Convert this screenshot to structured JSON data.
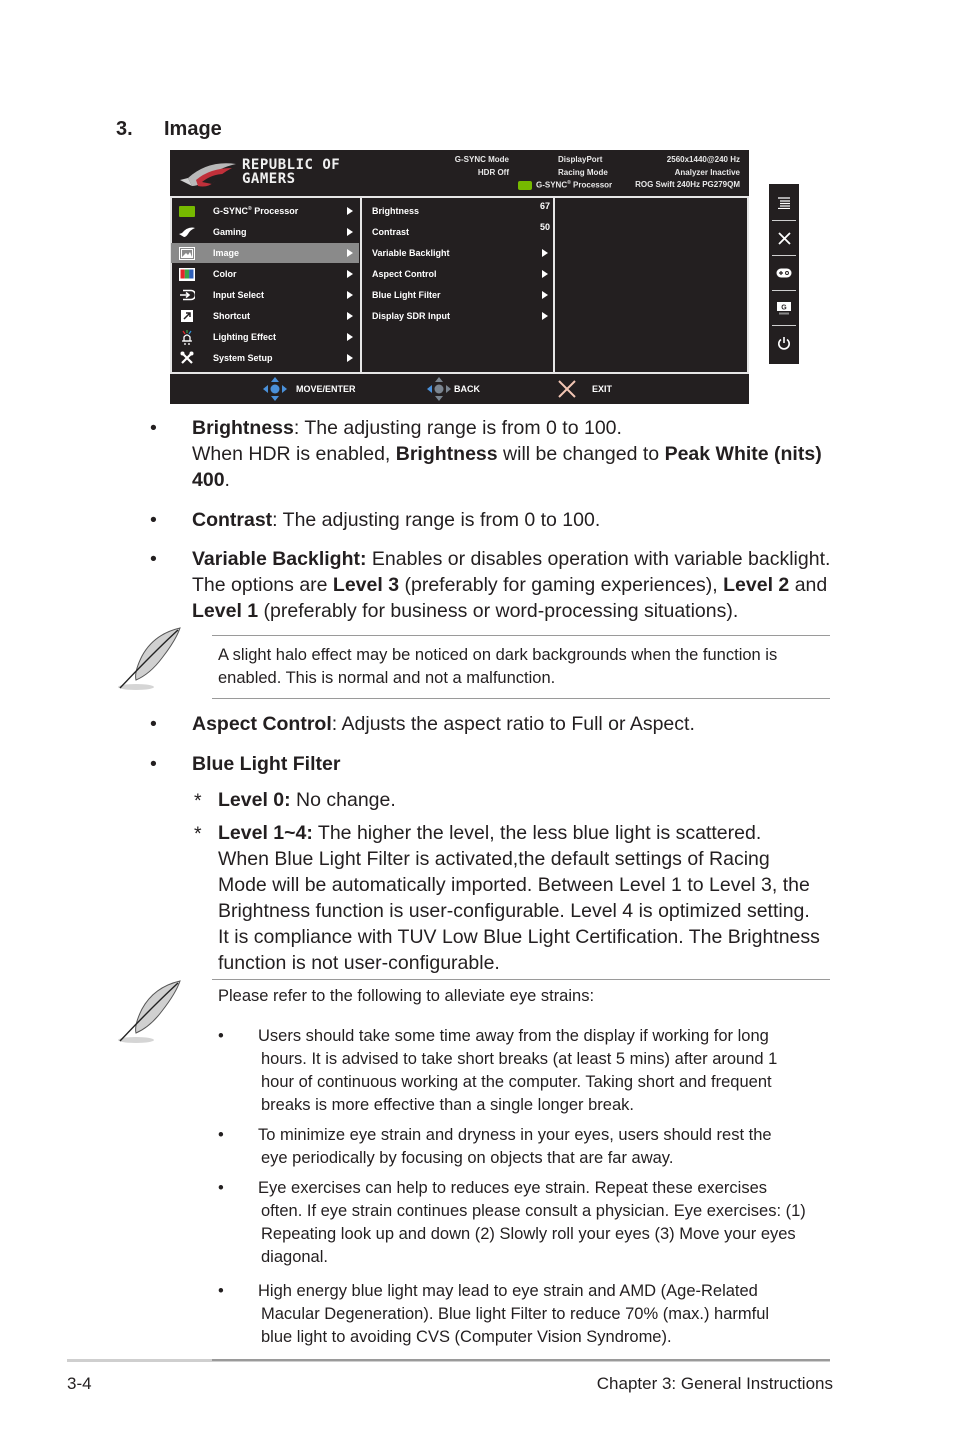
{
  "section": {
    "number": "3.",
    "title": "Image"
  },
  "osd": {
    "brand": {
      "line1": "REPUBLIC OF",
      "line2": "GAMERS"
    },
    "status": {
      "col1": [
        "G-SYNC Mode",
        "HDR Off"
      ],
      "col2": [
        "DisplayPort",
        "Racing Mode"
      ],
      "col2_processor": "G-SYNC",
      "col2_processor_suffix": " Processor",
      "col3": [
        "2560x1440@240 Hz",
        "Analyzer Inactive",
        "ROG Swift 240Hz PG279QM"
      ]
    },
    "main_menu": [
      {
        "label": "G-SYNC",
        "suffix": " Processor",
        "icon": "nvidia-icon",
        "selected": false
      },
      {
        "label": "Gaming",
        "icon": "rog-eye-icon",
        "selected": false
      },
      {
        "label": "Image",
        "icon": "image-icon",
        "selected": true
      },
      {
        "label": "Color",
        "icon": "color-icon",
        "selected": false
      },
      {
        "label": "Input Select",
        "icon": "input-select-icon",
        "selected": false
      },
      {
        "label": "Shortcut",
        "icon": "shortcut-icon",
        "selected": false
      },
      {
        "label": "Lighting Effect",
        "icon": "lighting-icon",
        "selected": false
      },
      {
        "label": "System Setup",
        "icon": "wrench-screwdriver-icon",
        "selected": false
      }
    ],
    "sub_menu": [
      {
        "label": "Brightness",
        "value": "67"
      },
      {
        "label": "Contrast",
        "value": "50"
      },
      {
        "label": "Variable Backlight",
        "value": null
      },
      {
        "label": "Aspect Control",
        "value": null
      },
      {
        "label": "Blue Light Filter",
        "value": null
      },
      {
        "label": "Display SDR Input",
        "value": null
      }
    ],
    "footer": {
      "move_enter": "MOVE/ENTER",
      "back": "BACK",
      "exit": "EXIT"
    },
    "side_buttons": [
      "menu-icon",
      "close-icon",
      "gamepad-icon",
      "gameplus-icon",
      "power-icon"
    ],
    "colors": {
      "background": "#231f20",
      "selected": "#8a8a8a",
      "nvidia_green": "#76b900",
      "dpad_blue": "#4a90d9",
      "exit_x": "#f3c6b4"
    }
  },
  "body": {
    "brightness": {
      "term": "Brightness",
      "text1": ": The adjusting range is from 0 to 100.",
      "text2a": "When HDR is enabled, ",
      "term2": "Brightness",
      "text2b": " will be changed to ",
      "term3": "Peak White (nits)",
      "term4": "400",
      "text2c": "."
    },
    "contrast": {
      "term": "Contrast",
      "text": ": The adjusting range is from 0 to 100."
    },
    "variable_backlight": {
      "term": "Variable Backlight:",
      "text1": " Enables or disables operation with variable backlight.",
      "text2a": "The options are ",
      "l3": "Level 3",
      "text2b": " (preferably for gaming experiences), ",
      "l2": "Level 2",
      "text2c": " and",
      "l1": "Level 1",
      "text3": " (preferably for business or word-processing situations)."
    },
    "note1": {
      "line1": "A slight halo effect may be noticed on dark backgrounds when the function is",
      "line2": "enabled. This is normal and not a malfunction."
    },
    "aspect_control": {
      "term": "Aspect Control",
      "text": ": Adjusts the aspect ratio to Full or Aspect."
    },
    "blue_light_filter": {
      "term": "Blue Light Filter",
      "level0_term": "Level 0:",
      "level0_text": " No change.",
      "level14_term": "Level 1~4:",
      "level14_line1": " The higher the level, the less blue light is scattered.",
      "lines": [
        "When Blue Light Filter is activated,the default settings of Racing",
        "Mode will be automatically imported. Between Level 1 to Level 3, the",
        "Brightness function is user-configurable. Level 4 is optimized setting.",
        "It is compliance with TUV Low Blue Light Certification. The Brightness",
        "function is not user-configurable."
      ]
    },
    "note2": {
      "intro": "Please refer to the following to alleviate eye strains:",
      "items": [
        [
          "Users should take some time away from the display if working for long",
          "hours. It is advised to take short breaks (at least 5 mins) after around 1",
          "hour of continuous working at the computer. Taking short and frequent",
          "breaks is more effective than a single longer break."
        ],
        [
          "To minimize eye strain and dryness in your eyes, users should rest the",
          "eye periodically by focusing on objects that are far away."
        ],
        [
          "Eye exercises can help to reduces eye strain. Repeat these exercises",
          "often. If eye strain continues please consult a physician. Eye exercises: (1)",
          "Repeating look up and down (2) Slowly roll your eyes (3) Move your eyes",
          "diagonal."
        ],
        [
          "High energy blue light may lead to eye strain and AMD (Age-Related",
          "Macular Degeneration). Blue light Filter to reduce 70% (max.) harmful",
          "blue light to avoiding CVS (Computer Vision Syndrome)."
        ]
      ]
    },
    "bullet_glyph": "•",
    "star_glyph": "*"
  },
  "footer": {
    "page": "3-4",
    "chapter": "Chapter 3: General Instructions"
  }
}
